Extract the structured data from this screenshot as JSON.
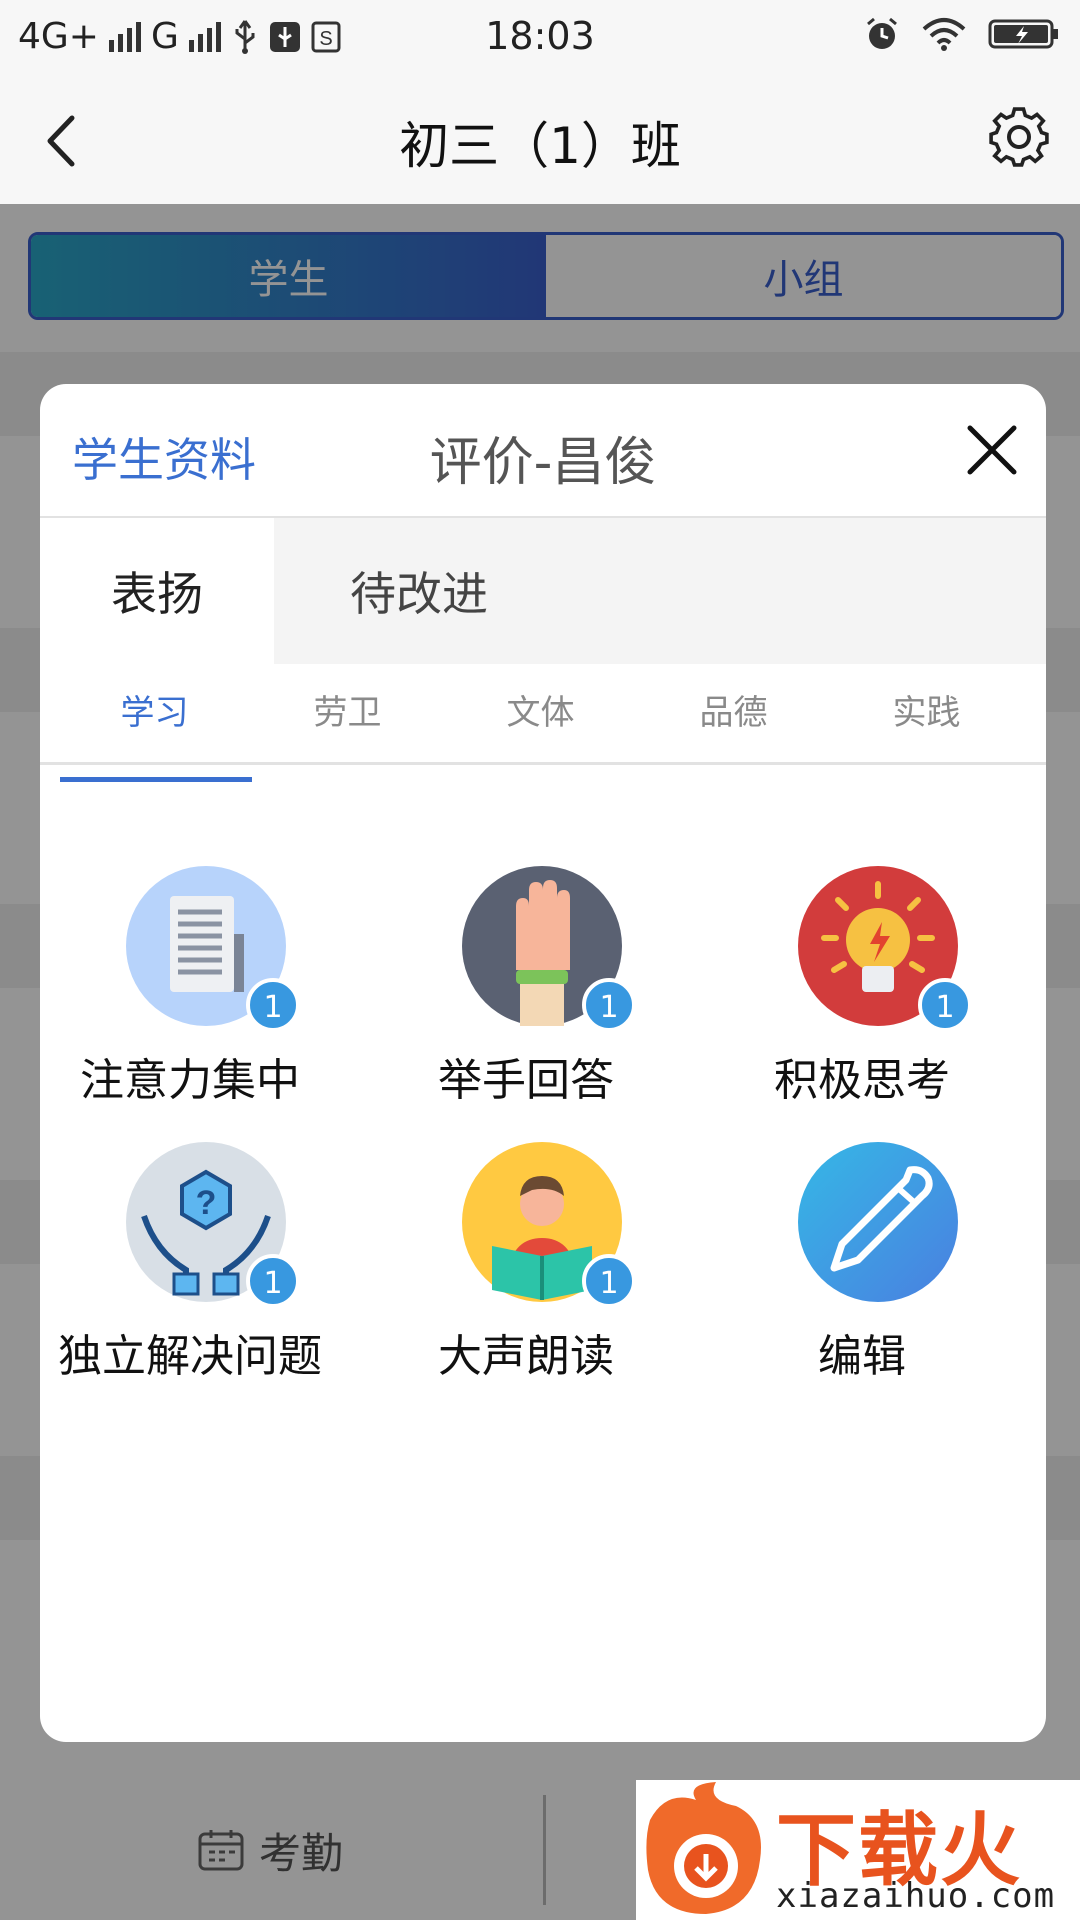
{
  "status_bar": {
    "network_left": "4G+",
    "network_g": "G",
    "time": "18:03"
  },
  "nav": {
    "title": "初三（1）班",
    "back_icon": "chevron-left-icon",
    "settings_icon": "gear-icon"
  },
  "background": {
    "segment_tabs": [
      "学生",
      "小组"
    ],
    "bottom_tab_label": "考勤"
  },
  "modal": {
    "profile_link": "学生资料",
    "title": "评价-昌俊",
    "close_icon": "close-icon",
    "type_tabs": [
      "表扬",
      "待改进"
    ],
    "category_tabs": [
      "学习",
      "劳卫",
      "文体",
      "品德",
      "实践"
    ],
    "active_category": "学习",
    "items": [
      {
        "label": "注意力集中",
        "badge": "1",
        "icon": "document-icon",
        "color": "#b7d3fb"
      },
      {
        "label": "举手回答",
        "badge": "1",
        "icon": "raised-hand-icon",
        "color": "#5a6172"
      },
      {
        "label": "积极思考",
        "badge": "1",
        "icon": "lightbulb-icon",
        "color": "#d23c3c"
      },
      {
        "label": "独立解决问题",
        "badge": "1",
        "icon": "hands-question-icon",
        "color": "#d8dfe6"
      },
      {
        "label": "大声朗读",
        "badge": "1",
        "icon": "reading-person-icon",
        "color": "#ffc941"
      },
      {
        "label": "编辑",
        "badge": "",
        "icon": "pencil-icon",
        "color": "#3aa2e2"
      }
    ]
  },
  "watermark": {
    "text": "下载火",
    "url": "xiazaihuo.com"
  }
}
